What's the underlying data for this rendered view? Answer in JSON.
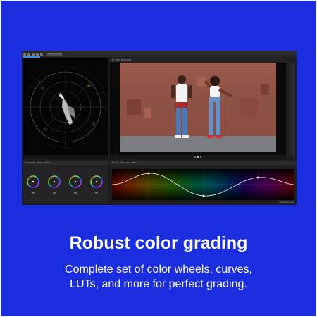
{
  "app": {
    "toolbar": {
      "tab_label": "Effects Controls"
    },
    "viewer": {
      "header_items": [
        "Fit",
        "Full",
        "00:00:12:08"
      ],
      "nav_dots": 3,
      "active_dot": 1
    },
    "grading": {
      "tabs": [
        "Lumetri Color",
        "Basic",
        "Creative"
      ],
      "wheels": [
        "Shadows",
        "Midtones",
        "Highlights",
        "Global"
      ]
    },
    "curves": {
      "tabs": [
        "Curves",
        "Hue vs Sat",
        "RGB"
      ],
      "status": "Hue Saturation Curve"
    }
  },
  "headline": "Robust color grading",
  "subtext": {
    "line1": "Complete set of color wheels, curves,",
    "line2": "LUTs, and more for perfect grading."
  },
  "colors": {
    "background": "#1a2ee0",
    "app_bg": "#1c1c1e",
    "accent": "#3a8df0"
  }
}
